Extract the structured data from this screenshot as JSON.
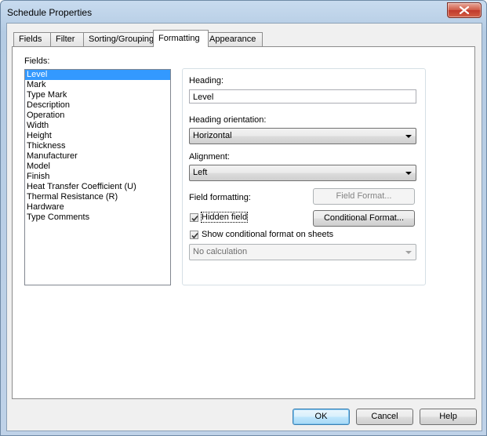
{
  "window": {
    "title": "Schedule Properties"
  },
  "tabs": [
    {
      "label": "Fields"
    },
    {
      "label": "Filter"
    },
    {
      "label": "Sorting/Grouping"
    },
    {
      "label": "Formatting"
    },
    {
      "label": "Appearance"
    }
  ],
  "active_tab": "Formatting",
  "fields": {
    "label": "Fields:",
    "items": [
      "Level",
      "Mark",
      "Type Mark",
      "Description",
      "Operation",
      "Width",
      "Height",
      "Thickness",
      "Manufacturer",
      "Model",
      "Finish",
      "Heat Transfer Coefficient (U)",
      "Thermal Resistance (R)",
      "Hardware",
      "Type Comments"
    ],
    "selected": "Level"
  },
  "formatting": {
    "heading_label": "Heading:",
    "heading_value": "Level",
    "orientation_label": "Heading orientation:",
    "orientation_value": "Horizontal",
    "alignment_label": "Alignment:",
    "alignment_value": "Left",
    "field_formatting_label": "Field formatting:",
    "field_format_button": "Field Format...",
    "hidden_field_label": "Hidden field",
    "hidden_field_checked": true,
    "conditional_format_button": "Conditional Format...",
    "show_conditional_label": "Show conditional format on sheets",
    "show_conditional_checked": true,
    "calculation_value": "No calculation"
  },
  "buttons": {
    "ok": "OK",
    "cancel": "Cancel",
    "help": "Help"
  }
}
